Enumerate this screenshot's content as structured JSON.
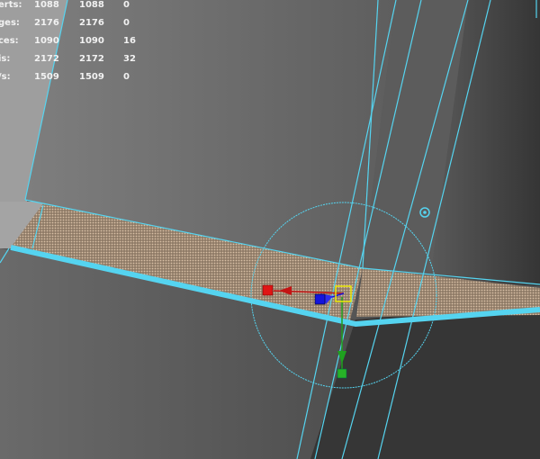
{
  "hud": {
    "rows": [
      {
        "label": "erts:",
        "v1": "1088",
        "v2": "1088",
        "v3": "0"
      },
      {
        "label": "ges:",
        "v1": "2176",
        "v2": "2176",
        "v3": "0"
      },
      {
        "label": "ces:",
        "v1": "1090",
        "v2": "1090",
        "v3": "16"
      },
      {
        "label": "is:",
        "v1": "2172",
        "v2": "2172",
        "v3": "32"
      },
      {
        "label": "/s:",
        "v1": "1509",
        "v2": "1509",
        "v3": "0"
      }
    ]
  },
  "colors": {
    "background": "#4f4f4f",
    "wireframe": "#55d4f0",
    "selected_face": "#b89a7e",
    "hud_text": "#f2f2f2",
    "manip_x": "#e01515",
    "manip_y": "#1fa11f",
    "manip_z": "#1414dd",
    "manip_center": "#f0f000"
  },
  "manipulator": {
    "type": "move-tool",
    "axes": [
      "x-handle-icon",
      "y-handle-icon",
      "z-handle-icon"
    ]
  }
}
